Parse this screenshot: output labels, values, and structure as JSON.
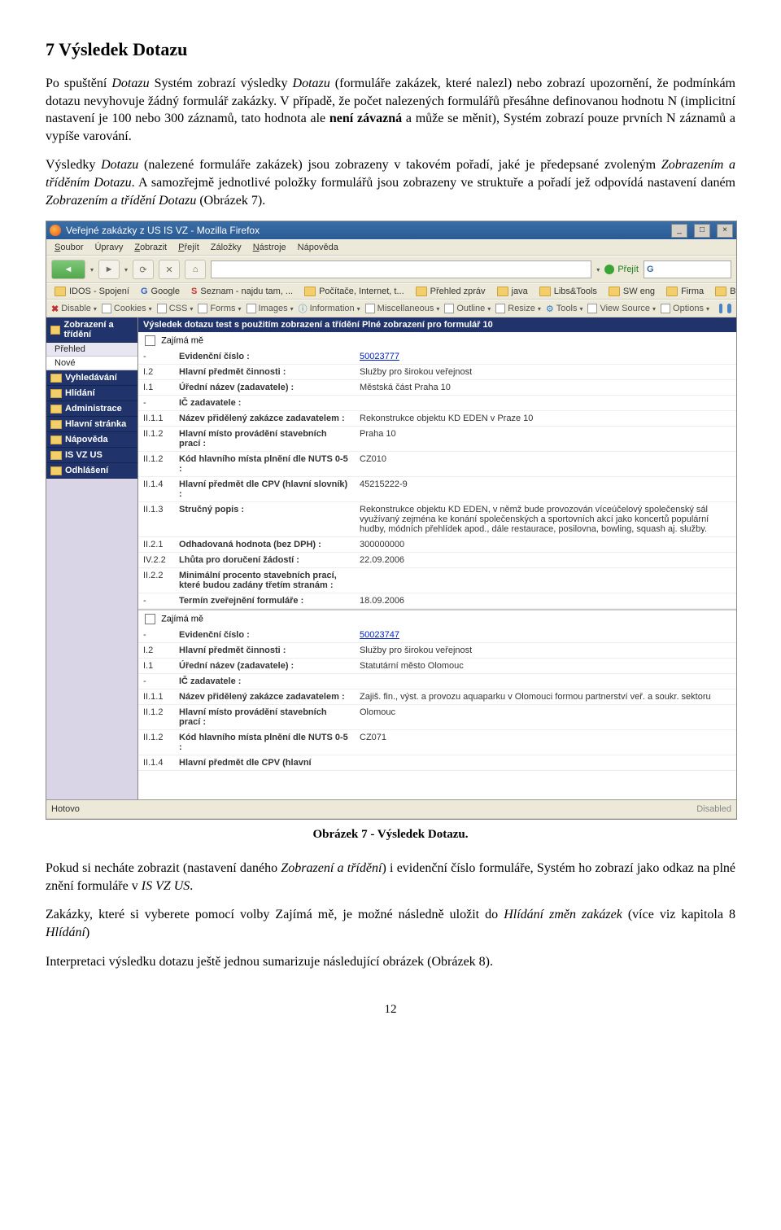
{
  "heading": "7  Výsledek Dotazu",
  "para1": "Po spuštění Dotazu Systém zobrazí výsledky Dotazu (formuláře zakázek, které nalezl) nebo zobrazí upozornění, že podmínkám dotazu nevyhovuje žádný formulář zakázky. V případě, že počet nalezených formulářů přesáhne definovanou hodnotu N (implicitní nastavení je 100 nebo 300 záznamů, tato hodnota ale není závazná a může se měnit), Systém zobrazí pouze prvních N záznamů a vypíše varování.",
  "para2": "Výsledky Dotazu (nalezené formuláře zakázek) jsou zobrazeny v takovém pořadí, jaké je předepsané zvoleným Zobrazením a tříděním Dotazu. A samozřejmě jednotlivé položky formulářů jsou zobrazeny ve struktuře a pořadí jež odpovídá nastavení daném Zobrazením a třídění Dotazu (Obrázek 7).",
  "para2_bold": "není závazná",
  "caption": "Obrázek 7 - Výsledek Dotazu.",
  "para3_a": "Pokud si necháte zobrazit (nastavení daného ",
  "para3_i1": "Zobrazení a třídění",
  "para3_b": ") i evidenční číslo formuláře, Systém ho zobrazí jako odkaz na plné znění formuláře v ",
  "para3_i2": "IS VZ US",
  "para3_c": ".",
  "para4_a": "Zakázky, které si vyberete pomocí volby Zajímá mě, je možné následně uložit do ",
  "para4_i1": "Hlídání změn zakázek",
  "para4_b": " (více viz kapitola 8 ",
  "para4_i2": "Hlídání",
  "para4_c": ")",
  "para5": "Interpretaci výsledku dotazu ještě jednou sumarizuje následující obrázek (Obrázek 8).",
  "page_number": "12",
  "window": {
    "title": "Veřejné zakázky z US IS VZ - Mozilla Firefox",
    "menubar": [
      "Soubor",
      "Úpravy",
      "Zobrazit",
      "Přejít",
      "Záložky",
      "Nástroje",
      "Nápověda"
    ],
    "go_label": "Přejít",
    "search_placeholder": "G",
    "bookmarks": [
      "IDOS - Spojení",
      "Google",
      "Seznam - najdu tam, ...",
      "Počítače, Internet, t...",
      "Přehled zpráv",
      "java",
      "Libs&Tools",
      "SW eng",
      "Firma",
      "Bydleni"
    ],
    "devtoolbar": [
      "Disable",
      "Cookies",
      "CSS",
      "Forms",
      "Images",
      "Information",
      "Miscellaneous",
      "Outline",
      "Resize",
      "Tools",
      "View Source",
      "Options"
    ],
    "content_title": "Výsledek dotazu test s použitím zobrazení a třídění Plné zobrazení pro formulář 10",
    "sidebar": [
      {
        "head": "Zobrazení a třídění",
        "subs": [
          "Přehled",
          "Nové"
        ]
      },
      {
        "head": "Vyhledávání"
      },
      {
        "head": "Hlídání"
      },
      {
        "head": "Administrace"
      },
      {
        "head": "Hlavní stránka"
      },
      {
        "head": "Nápověda"
      },
      {
        "head": "IS VZ US"
      },
      {
        "head": "Odhlášení"
      }
    ],
    "zajima": "Zajímá mě",
    "record1": [
      {
        "k": "-",
        "lbl": "Evidenční číslo :",
        "val": "50023777",
        "link": true
      },
      {
        "k": "I.2",
        "lbl": "Hlavní předmět činnosti :",
        "val": "Služby pro širokou veřejnost"
      },
      {
        "k": "I.1",
        "lbl": "Úřední název (zadavatele) :",
        "val": "Městská část Praha 10"
      },
      {
        "k": "-",
        "lbl": "IČ zadavatele :",
        "val": ""
      },
      {
        "k": "II.1.1",
        "lbl": "Název přidělený zakázce zadavatelem :",
        "val": "Rekonstrukce objektu KD EDEN v Praze 10"
      },
      {
        "k": "II.1.2",
        "lbl": "Hlavní místo provádění stavebních prací :",
        "val": "Praha 10"
      },
      {
        "k": "II.1.2",
        "lbl": "Kód hlavního místa plnění dle NUTS 0-5 :",
        "val": "CZ010"
      },
      {
        "k": "II.1.4",
        "lbl": "Hlavní předmět dle CPV (hlavní slovník) :",
        "val": "45215222-9"
      },
      {
        "k": "II.1.3",
        "lbl": "Stručný popis :",
        "val": "Rekonstrukce objektu KD EDEN, v němž bude provozován víceúčelový společenský sál využívaný zejména ke konání společenských a sportovních akcí jako koncertů populární hudby, módních přehlídek apod., dále restaurace, posilovna, bowling, squash aj. služby."
      },
      {
        "k": "II.2.1",
        "lbl": "Odhadovaná hodnota (bez DPH) :",
        "val": "300000000"
      },
      {
        "k": "IV.2.2",
        "lbl": "Lhůta pro doručení žádostí :",
        "val": "22.09.2006"
      },
      {
        "k": "II.2.2",
        "lbl": "Minimální procento stavebních prací, které budou zadány třetím stranám :",
        "val": ""
      },
      {
        "k": "-",
        "lbl": "Termín zveřejnění formuláře :",
        "val": "18.09.2006"
      }
    ],
    "record2": [
      {
        "k": "-",
        "lbl": "Evidenční číslo :",
        "val": "50023747",
        "link": true
      },
      {
        "k": "I.2",
        "lbl": "Hlavní předmět činnosti :",
        "val": "Služby pro širokou veřejnost"
      },
      {
        "k": "I.1",
        "lbl": "Úřední název (zadavatele) :",
        "val": "Statutární město Olomouc"
      },
      {
        "k": "-",
        "lbl": "IČ zadavatele :",
        "val": ""
      },
      {
        "k": "II.1.1",
        "lbl": "Název přidělený zakázce zadavatelem :",
        "val": "Zajiš. fin., výst. a provozu aquaparku v Olomouci formou partnerství veř. a soukr. sektoru"
      },
      {
        "k": "II.1.2",
        "lbl": "Hlavní místo provádění stavebních prací :",
        "val": "Olomouc"
      },
      {
        "k": "II.1.2",
        "lbl": "Kód hlavního místa plnění dle NUTS 0-5 :",
        "val": "CZ071"
      },
      {
        "k": "II.1.4",
        "lbl": "Hlavní předmět dle CPV (hlavní",
        "val": ""
      }
    ],
    "status_left": "Hotovo",
    "status_right": "Disabled"
  }
}
